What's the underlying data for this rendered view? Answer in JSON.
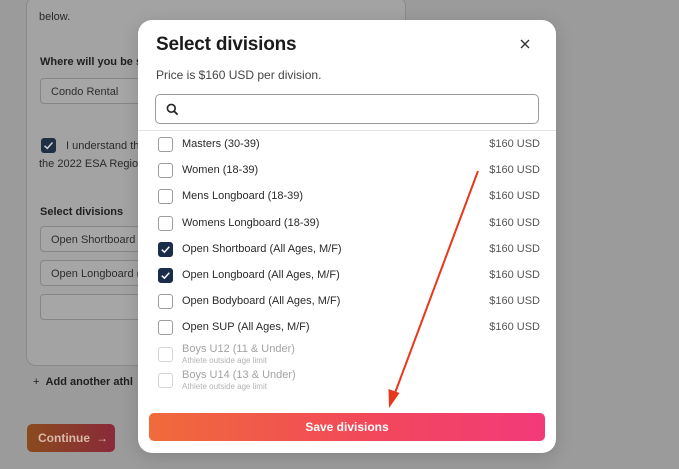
{
  "background": {
    "top_text": "below.",
    "stay_label": "Where will you be st",
    "stay_value": "Condo Rental",
    "agree_text_line1": "I understand th",
    "agree_text_line2": "the 2022 ESA Regio",
    "select_divisions_label": "Select divisions",
    "selected_items": [
      "Open Shortboard (A",
      "Open Longboard (A",
      ""
    ],
    "add_athlete_label": "Add another athl",
    "continue_label": "Continue"
  },
  "modal": {
    "title": "Select divisions",
    "subtitle": "Price is $160 USD per division.",
    "search_placeholder": "",
    "save_label": "Save divisions",
    "colors": {
      "checked": "#1b2d4a",
      "save_from": "#f06b3a",
      "save_to": "#f23a7a",
      "arrow": "#e8371b"
    },
    "divisions": [
      {
        "label": "Masters (30-39)",
        "price": "$160 USD",
        "checked": false,
        "disabled": false
      },
      {
        "label": "Women (18-39)",
        "price": "$160 USD",
        "checked": false,
        "disabled": false
      },
      {
        "label": "Mens Longboard (18-39)",
        "price": "$160 USD",
        "checked": false,
        "disabled": false
      },
      {
        "label": "Womens Longboard (18-39)",
        "price": "$160 USD",
        "checked": false,
        "disabled": false
      },
      {
        "label": "Open Shortboard (All Ages, M/F)",
        "price": "$160 USD",
        "checked": true,
        "disabled": false
      },
      {
        "label": "Open Longboard (All Ages, M/F)",
        "price": "$160 USD",
        "checked": true,
        "disabled": false
      },
      {
        "label": "Open Bodyboard (All Ages, M/F)",
        "price": "$160 USD",
        "checked": false,
        "disabled": false
      },
      {
        "label": "Open SUP (All Ages, M/F)",
        "price": "$160 USD",
        "checked": false,
        "disabled": false
      },
      {
        "label": "Boys U12 (11 & Under)",
        "note": "Athlete outside age limit",
        "price": "",
        "checked": false,
        "disabled": true
      },
      {
        "label": "Boys U14 (13 & Under)",
        "note": "Athlete outside age limit",
        "price": "",
        "checked": false,
        "disabled": true
      }
    ]
  }
}
